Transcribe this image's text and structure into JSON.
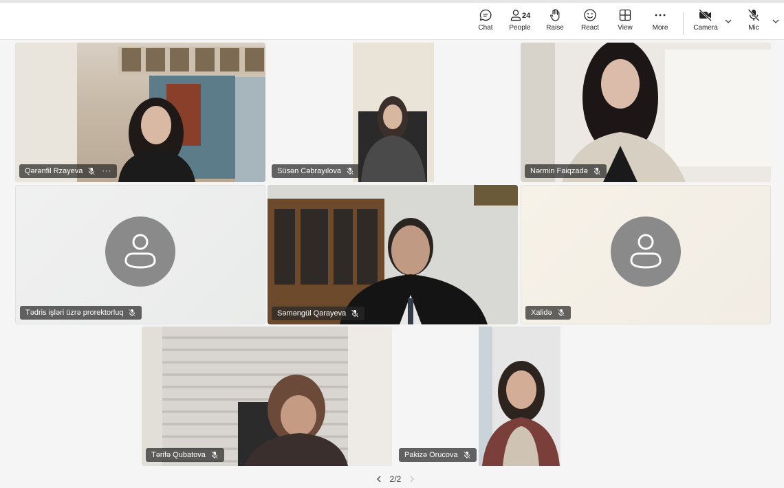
{
  "toolbar": {
    "chat_label": "Chat",
    "people_label": "People",
    "people_count": "24",
    "raise_label": "Raise",
    "react_label": "React",
    "view_label": "View",
    "more_label": "More",
    "camera_label": "Camera",
    "mic_label": "Mic"
  },
  "participants": [
    {
      "name": "Qərənfil Rzayeva",
      "more": "···"
    },
    {
      "name": "Süsən Cəbrayılova"
    },
    {
      "name": "Nərmin Faiqzadə"
    },
    {
      "name": "Tədris işləri üzrə prorektorluq"
    },
    {
      "name": "Səməngül Qarayeva"
    },
    {
      "name": "Xalidə"
    },
    {
      "name": "Tərifə Qubatova"
    },
    {
      "name": "Pakizə Orucova"
    }
  ],
  "pager": {
    "label": "2/2"
  },
  "colors": {
    "accent": "#242424",
    "tile_border": "#e0e0e0",
    "avatar": "#8a8a8a",
    "nametag_bg": "rgba(40,40,40,0.72)"
  }
}
